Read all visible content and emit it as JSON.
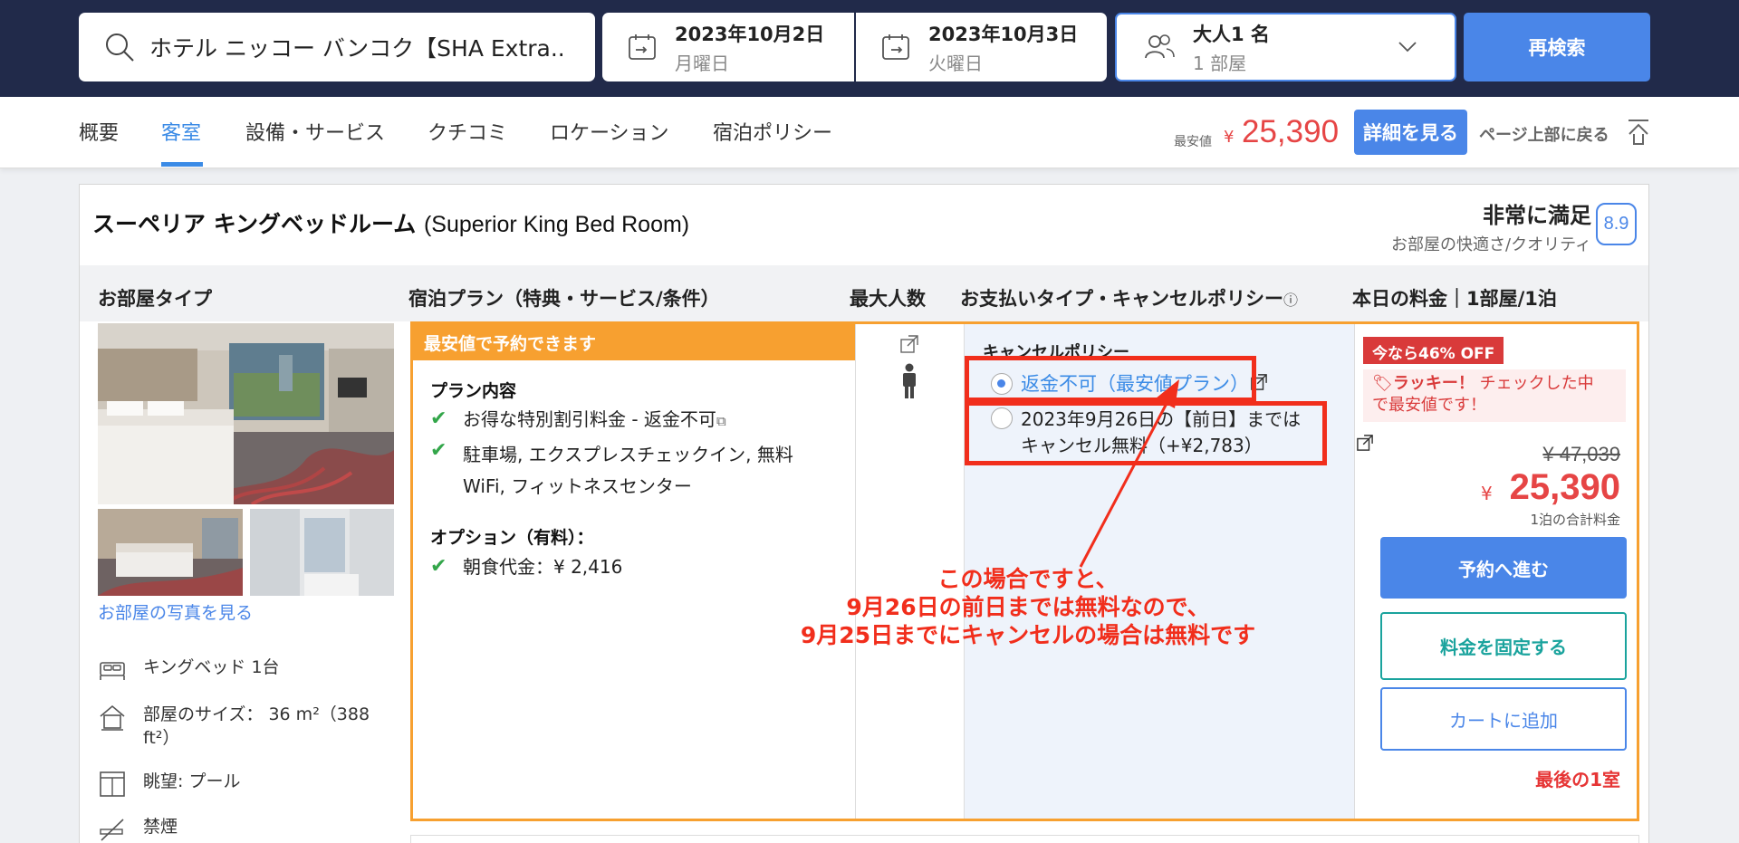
{
  "search": {
    "hotel_name": "ホテル ニッコー バンコク【SHA Extra...",
    "checkin_date": "2023年10月2日",
    "checkin_day": "月曜日",
    "checkout_date": "2023年10月3日",
    "checkout_day": "火曜日",
    "guests": "大人1 名",
    "rooms": "1 部屋",
    "research_label": "再検索"
  },
  "nav": {
    "tabs": [
      {
        "label": "概要"
      },
      {
        "label": "客室"
      },
      {
        "label": "設備・サービス"
      },
      {
        "label": "クチコミ"
      },
      {
        "label": "ロケーション"
      },
      {
        "label": "宿泊ポリシー"
      }
    ],
    "active_tab": "客室",
    "min_price_label": "最安値",
    "currency": "¥",
    "min_price": "25,390",
    "detail_label": "詳細を見る",
    "back_to_top_label": "ページ上部に戻る"
  },
  "room": {
    "title_ja": "スーペリア キングベッドルーム",
    "title_en": "(Superior King Bed Room)",
    "rating_text": "非常に満足",
    "rating_sub": "お部屋の快適さ/クオリティ",
    "score": "8.9",
    "columns": {
      "room_type": "お部屋タイプ",
      "plan": "宿泊プラン（特典・サービス/条件）",
      "max_people": "最大人数",
      "payment": "お支払いタイプ・キャンセルポリシー",
      "price": "本日の料金｜1部屋/1泊"
    },
    "photos_link": "お部屋の写真を見る",
    "amenities": [
      {
        "icon": "bed-icon",
        "label": "キングベッド 1台"
      },
      {
        "icon": "room-size-icon",
        "label": "部屋のサイズ： 36 m²（388 ft²）"
      },
      {
        "icon": "view-icon",
        "label": "眺望: プール"
      },
      {
        "icon": "no-smoking-icon",
        "label": "禁煙"
      }
    ]
  },
  "plan": {
    "header": "最安値で予約できます",
    "contents_label": "プラン内容",
    "items": [
      "お得な特別割引料金 - 返金不可",
      "駐車場, エクスプレスチェックイン, 無料WiFi, フィットネスセンター"
    ],
    "options_label": "オプション（有料）：",
    "options": [
      "朝食代金：¥ 2,416"
    ]
  },
  "cancel": {
    "title": "キャンセルポリシー",
    "option1": "返金不可（最安値プラン）",
    "option2_line1": "2023年9月26日の【前日】までは",
    "option2_line2": "キャンセル無料（+¥2,783）"
  },
  "price": {
    "badge": "今なら46% OFF",
    "lucky_title": "ラッキー！",
    "lucky_text_1": "チェックした中",
    "lucky_text_2": "で最安値です！",
    "old_price": "¥ 47,039",
    "currency": "¥",
    "price": "25,390",
    "total_label": "1泊の合計料金",
    "book_label": "予約へ進む",
    "lock_label": "料金を固定する",
    "cart_label": "カートに追加",
    "last_room": "最後の1室"
  },
  "annotation": {
    "line1": "この場合ですと、",
    "line2": "9月26日の前日までは無料なので、",
    "line3": "9月25日までにキャンセルの場合は無料です"
  },
  "colors": {
    "header_bg": "#212a4a",
    "accent_blue": "#4a86e8",
    "plan_orange": "#f7a030",
    "price_red": "#e64545",
    "annotation_red": "#f12e1c",
    "check_green": "#33a64a",
    "teal": "#1aa39d"
  }
}
